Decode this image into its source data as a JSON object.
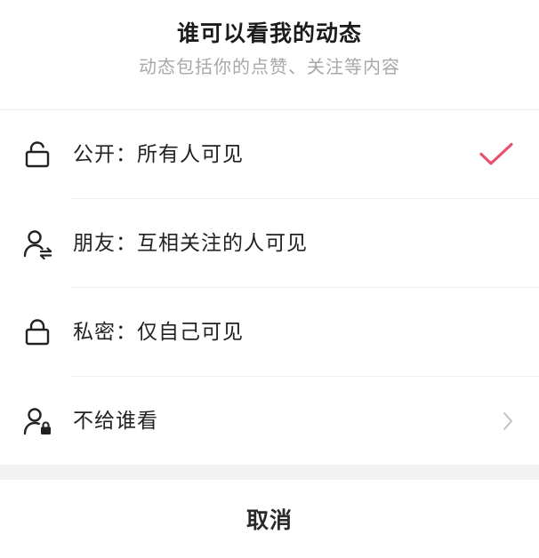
{
  "header": {
    "title": "谁可以看我的动态",
    "subtitle": "动态包括你的点赞、关注等内容"
  },
  "options": [
    {
      "label": "公开：所有人可见",
      "icon": "unlock-icon",
      "selected": true,
      "trailing": "check-icon"
    },
    {
      "label": "朋友：互相关注的人可见",
      "icon": "friends-icon",
      "selected": false,
      "trailing": ""
    },
    {
      "label": "私密：仅自己可见",
      "icon": "lock-icon",
      "selected": false,
      "trailing": ""
    },
    {
      "label": "不给谁看",
      "icon": "user-lock-icon",
      "selected": false,
      "trailing": "chevron-right-icon"
    }
  ],
  "footer": {
    "cancel_label": "取消"
  },
  "colors": {
    "accent": "#ea4f6b",
    "text": "#222222",
    "subtitle": "#a8a8a8",
    "divider": "#efefef",
    "chevron": "#c2c2c2"
  }
}
